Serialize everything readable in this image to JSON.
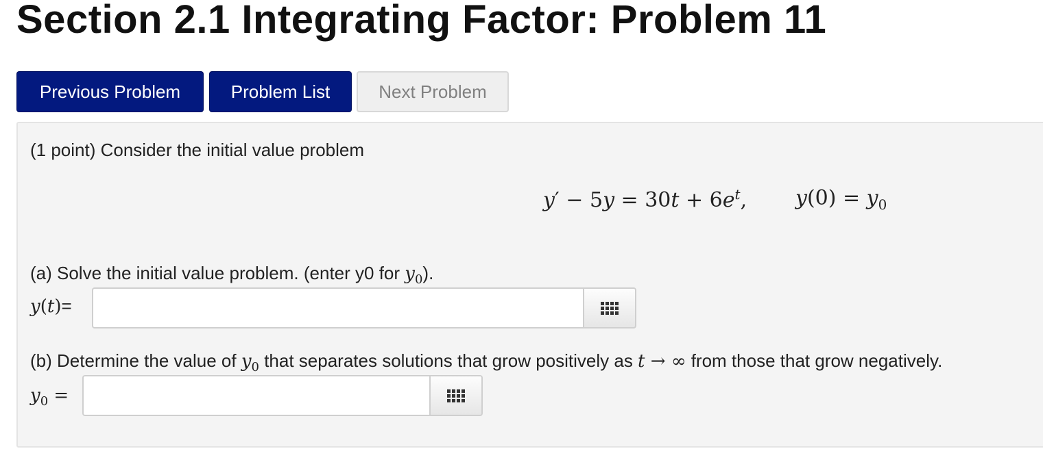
{
  "page": {
    "title": "Section 2.1 Integrating Factor: Problem 11"
  },
  "nav": {
    "previous_label": "Previous Problem",
    "list_label": "Problem List",
    "next_label": "Next Problem"
  },
  "problem": {
    "intro": "(1 point) Consider the initial value problem",
    "equation": {
      "lhs_y": "y",
      "prime": "′",
      "minus": " − 5",
      "lhs_y2": "y",
      "equals": " = 30",
      "t1": "t",
      "plus": " + 6",
      "e": "e",
      "t_sup": "t",
      "comma": ",",
      "ic_y": "y",
      "ic_arg": "(0) = ",
      "ic_y0": "y",
      "ic_sub": "0"
    },
    "part_a": {
      "text_before": "(a) Solve the initial value problem. (enter y0 for ",
      "var": "y",
      "sub": "0",
      "text_after": ").",
      "label_y": "y",
      "label_paren_open": "(",
      "label_t": "t",
      "label_paren_close": ")",
      "label_eq": "=",
      "input_value": "",
      "palette_icon": "grid-icon"
    },
    "part_b": {
      "text_before": "(b) Determine the value of ",
      "var": "y",
      "sub": "0",
      "text_middle": " that separates solutions that grow positively as ",
      "t": "t",
      "arrow": " → ∞",
      "text_after": " from those that grow negatively.",
      "label_y": "y",
      "label_sub": "0",
      "label_eq": " =",
      "input_value": "",
      "palette_icon": "grid-icon"
    }
  },
  "colors": {
    "primary_button": "#03197f",
    "disabled_button": "#efefef",
    "panel_background": "#f4f4f4"
  }
}
